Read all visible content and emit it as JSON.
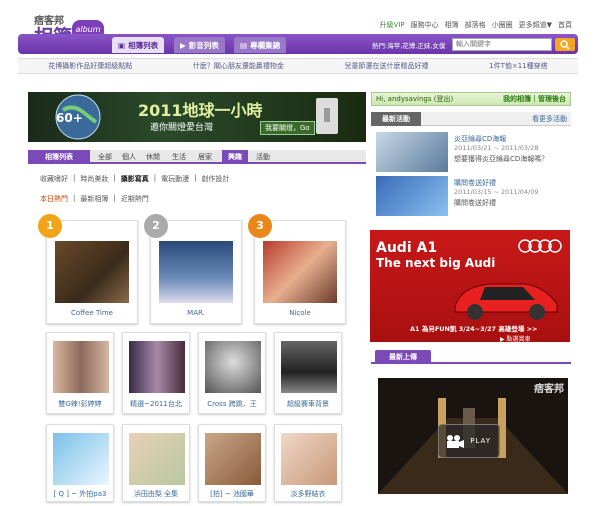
{
  "header": {
    "logo_small": "痞客邦",
    "logo_big": "相簿",
    "logo_badge": "album",
    "top_links": [
      "升級VIP",
      "服務中心",
      "相簿",
      "部落格",
      "小圈圈",
      "更多頻道▼",
      "首頁"
    ],
    "nav_tabs": [
      "相簿列表",
      "影音列表",
      "專欄集錦"
    ],
    "hot_words": "熱門:海苹,花博,正妹,女僕",
    "search_placeholder": "輸入關鍵字"
  },
  "promo_links": [
    "花博攝影作品好康超級點點",
    "什麼？關心朋友還能贏禮物金",
    "兒童節還在送什麼贈品好禮",
    "1件T恤×11種穿搭"
  ],
  "banner": {
    "title": "2011地球一小時",
    "subtitle": "邀你關燈愛台灣",
    "button": "我要關燈，Go"
  },
  "category_tabs": [
    "相簿列表",
    "全部",
    "個人",
    "休閒",
    "生活",
    "居家",
    "興趣",
    "活動"
  ],
  "sub_tabs": [
    "收藏嗜好",
    "時尚美妝",
    "攝影寫真",
    "電玩動漫",
    "創作設計"
  ],
  "sort_tabs": [
    "本日熱門",
    "最新相簿",
    "近期熱門"
  ],
  "top_albums": [
    {
      "rank": "1",
      "title": "Coffee Time"
    },
    {
      "rank": "2",
      "title": "MAR."
    },
    {
      "rank": "3",
      "title": "Nicole"
    }
  ],
  "albums_row2": [
    "雙G辣!彭婷婷",
    "精選~2011台北",
    "Cross 跨跳．王",
    "超級賽車背景"
  ],
  "albums_row3": [
    "[ Q ] ~ 外拍pa3",
    "浜田由梨 全集",
    "[拍] ~ 池國華",
    "淡多野結衣"
  ],
  "user": {
    "greeting": "Hi, andysavings (登出)",
    "links": "我的相簿｜管理後台"
  },
  "news": {
    "label": "最新活動",
    "more": "看更多活動",
    "items": [
      {
        "title": "炎亞綸尋CD海報",
        "date": "2011/03/21 ~ 2011/03/28",
        "desc": "想要獲得炎亞綸尋CD海報嗎？"
      },
      {
        "title": "購問卷送好禮",
        "date": "2011/03/15 ~ 2011/04/09",
        "desc": "購問卷送好禮"
      }
    ]
  },
  "ad": {
    "brand": "Audi A1",
    "tagline": "The next big Audi",
    "footer": "A1 為另FUN凱 3/24~3/27 高雄登場 >>",
    "note": "▶ 點選賞車"
  },
  "latest": {
    "label": "最新上傳",
    "play": "PLAY",
    "brand": "痞客邦"
  }
}
